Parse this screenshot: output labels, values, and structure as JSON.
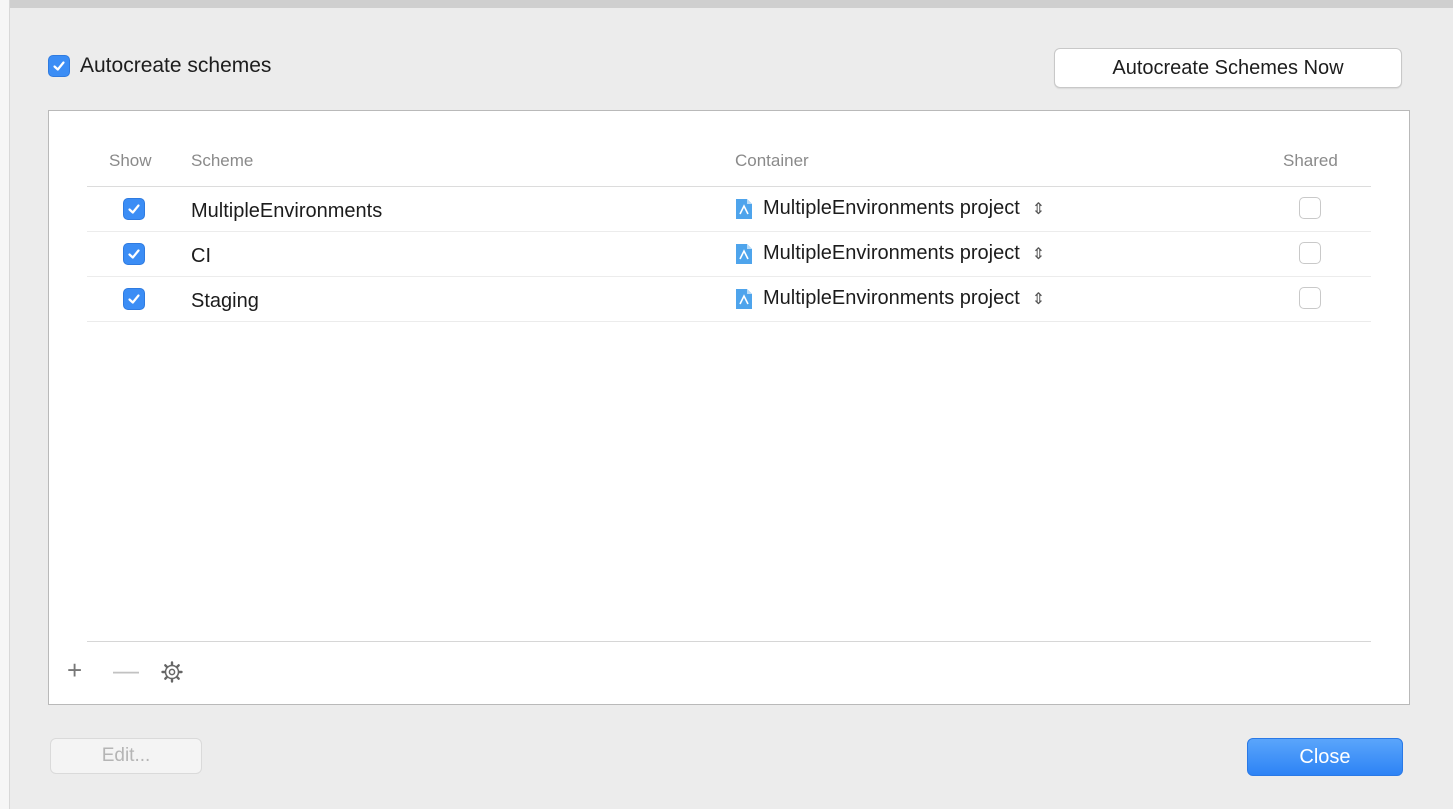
{
  "dialog": {
    "autocreate": {
      "label": "Autocreate schemes",
      "checked": true
    },
    "autocreate_now_label": "Autocreate Schemes Now",
    "table": {
      "headers": {
        "show": "Show",
        "scheme": "Scheme",
        "container": "Container",
        "shared": "Shared"
      },
      "rows": [
        {
          "show": true,
          "scheme": "MultipleEnvironments",
          "container": "MultipleEnvironments project",
          "shared": false
        },
        {
          "show": true,
          "scheme": "CI",
          "container": "MultipleEnvironments project",
          "shared": false
        },
        {
          "show": true,
          "scheme": "Staging",
          "container": "MultipleEnvironments project",
          "shared": false
        }
      ]
    },
    "toolbar": {
      "add": "+",
      "remove": "—",
      "settings_icon": "gear-icon"
    },
    "edit_label": "Edit...",
    "close_label": "Close",
    "colors": {
      "accent": "#3b8df5",
      "panel": "#ffffff",
      "background": "#ececec"
    }
  }
}
